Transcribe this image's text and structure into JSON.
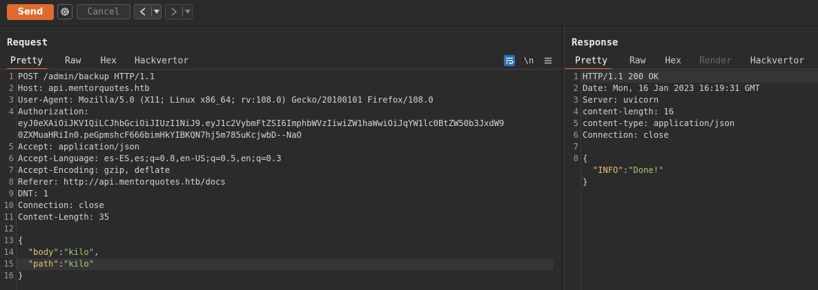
{
  "toolbar": {
    "send_label": "Send",
    "cancel_label": "Cancel",
    "back_arrow": "<",
    "forward_arrow": ">"
  },
  "request": {
    "title": "Request",
    "tabs": [
      "Pretty",
      "Raw",
      "Hex",
      "Hackvertor"
    ],
    "newline_toggle": "\\n",
    "lines": [
      {
        "n": "1",
        "text": "POST /admin/backup HTTP/1.1"
      },
      {
        "n": "2",
        "text": "Host: api.mentorquotes.htb"
      },
      {
        "n": "3",
        "text": "User-Agent: Mozilla/5.0 (X11; Linux x86_64; rv:108.0) Gecko/20100101 Firefox/108.0"
      },
      {
        "n": "4",
        "text": "Authorization:"
      },
      {
        "n": "",
        "text": "eyJ0eXAiOiJKV1QiLCJhbGciOiJIUzI1NiJ9.eyJ1c2VybmFtZSI6ImphbWVzIiwiZW1haWwiOiJqYW1lc0BtZW50b3JxdW9"
      },
      {
        "n": "",
        "text": "0ZXMuaHRiIn0.peGpmshcF666bimHkYIBKQN7hj5m785uKcjwbD--NaO"
      },
      {
        "n": "5",
        "text": "Accept: application/json"
      },
      {
        "n": "6",
        "text": "Accept-Language: es-ES,es;q=0.8,en-US;q=0.5,en;q=0.3"
      },
      {
        "n": "7",
        "text": "Accept-Encoding: gzip, deflate"
      },
      {
        "n": "8",
        "text": "Referer: http://api.mentorquotes.htb/docs"
      },
      {
        "n": "9",
        "text": "DNT: 1"
      },
      {
        "n": "10",
        "text": "Connection: close"
      },
      {
        "n": "11",
        "text": "Content-Length: 35"
      },
      {
        "n": "12",
        "text": ""
      },
      {
        "n": "13",
        "text": "{"
      },
      {
        "n": "14",
        "json": {
          "indent": "  ",
          "key": "\"body\"",
          "colon": ":",
          "value": "\"kilo\"",
          "tail": ","
        }
      },
      {
        "n": "15",
        "json": {
          "indent": "  ",
          "key": "\"path\"",
          "colon": ":",
          "value": "\"kilo\"",
          "tail": ""
        },
        "highlight": true
      },
      {
        "n": "16",
        "text": "}"
      }
    ]
  },
  "response": {
    "title": "Response",
    "tabs": [
      "Pretty",
      "Raw",
      "Hex",
      "Render",
      "Hackvertor"
    ],
    "lines": [
      {
        "n": "1",
        "text": "HTTP/1.1 200 OK",
        "highlight": true
      },
      {
        "n": "2",
        "text": "Date: Mon, 16 Jan 2023 16:19:31 GMT"
      },
      {
        "n": "3",
        "text": "Server: uvicorn"
      },
      {
        "n": "4",
        "text": "content-length: 16"
      },
      {
        "n": "5",
        "text": "content-type: application/json"
      },
      {
        "n": "6",
        "text": "Connection: close"
      },
      {
        "n": "7",
        "text": ""
      },
      {
        "n": "8",
        "text": "{"
      },
      {
        "n": "",
        "json": {
          "indent": "  ",
          "key": "\"INFO\"",
          "colon": ":",
          "value": "\"Done!\"",
          "tail": ""
        }
      },
      {
        "n": "",
        "text": "}"
      }
    ]
  },
  "colors": {
    "accent": "#e06b2f",
    "json_key": "#e8c070",
    "json_string": "#9ccf72",
    "background": "#2b2b2b"
  },
  "icons": [
    "settings-gear-icon",
    "chevron-left-icon",
    "chevron-right-icon",
    "caret-down-icon",
    "wrap-lines-icon",
    "newline-toggle-icon",
    "hamburger-menu-icon"
  ]
}
